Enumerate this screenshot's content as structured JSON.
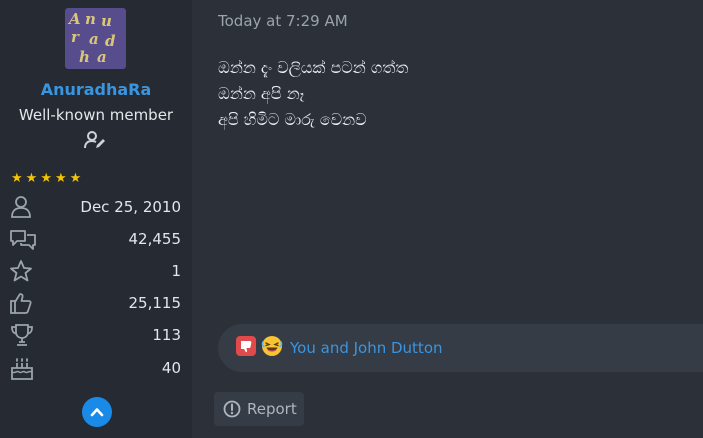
{
  "user": {
    "avatar_text": [
      "A",
      "n",
      "u",
      "r",
      "a",
      "d",
      "h",
      "a"
    ],
    "name": "AnuradhaRa",
    "title": "Well-known member",
    "stars": 5
  },
  "stats": [
    {
      "icon": "user-icon",
      "value": "Dec 25, 2010"
    },
    {
      "icon": "messages-icon",
      "value": "42,455"
    },
    {
      "icon": "star-outline-icon",
      "value": "1"
    },
    {
      "icon": "thumbs-up-icon",
      "value": "25,115"
    },
    {
      "icon": "trophy-icon",
      "value": "113"
    },
    {
      "icon": "birthday-cake-icon",
      "value": "40"
    }
  ],
  "post": {
    "timestamp": "Today at 7:29 AM",
    "lines": [
      "ඔන්න දැං වලියක් පටන් ගත්ත",
      "ඔන්න අපි නෑ",
      "අපි හිමිට මාරු වෙනව"
    ]
  },
  "reactions": {
    "text": "You and John Dutton"
  },
  "actions": {
    "report_label": "Report"
  },
  "colors": {
    "accent": "#3a95e0",
    "star": "#f5c400",
    "background": "#2b3039"
  }
}
